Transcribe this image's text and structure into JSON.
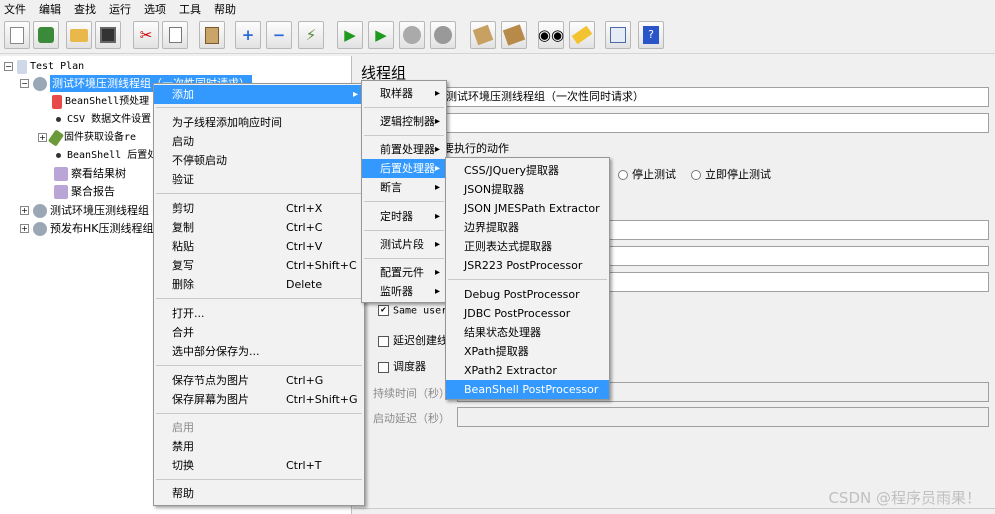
{
  "menubar": [
    "文件",
    "编辑",
    "查找",
    "运行",
    "选项",
    "工具",
    "帮助"
  ],
  "tree": {
    "test_plan": "Test Plan",
    "thread_group_1": "测试环境压测线程组（一次性同时请求）",
    "beanshell_pre": "BeanShell预处理",
    "csv": "CSV 数据文件设置",
    "fw_device": "固件获取设备re",
    "beanshell_post": "BeanShell 后置处",
    "view_results": "察看结果树",
    "aggregate": "聚合报告",
    "thread_group_2": "测试环境压测线程组",
    "thread_group_3": "预发布HK压测线程组"
  },
  "right": {
    "title": "线程组",
    "name_value": "测试环境压测线程组（一次性同时请求）",
    "action_label": "要执行的动作",
    "stop_test": "停止测试",
    "stop_now": "立即停止测试",
    "same_user": "Same user",
    "delay_create": "延迟创建线",
    "scheduler": "调度器",
    "duration": "持续时间（秒）",
    "startup_delay": "启动延迟（秒）"
  },
  "context_menu": {
    "add": "添加",
    "add_think_time": "为子线程添加响应时间",
    "start": "启动",
    "start_no_pause": "不停顿启动",
    "validate": "验证",
    "cut": "剪切",
    "cut_sc": "Ctrl+X",
    "copy": "复制",
    "copy_sc": "Ctrl+C",
    "paste": "粘贴",
    "paste_sc": "Ctrl+V",
    "duplicate": "复写",
    "duplicate_sc": "Ctrl+Shift+C",
    "delete": "删除",
    "delete_sc": "Delete",
    "open": "打开...",
    "merge": "合并",
    "save_selection": "选中部分保存为...",
    "save_node_image": "保存节点为图片",
    "save_node_image_sc": "Ctrl+G",
    "save_screen_image": "保存屏幕为图片",
    "save_screen_image_sc": "Ctrl+Shift+G",
    "enable": "启用",
    "disable": "禁用",
    "toggle": "切换",
    "toggle_sc": "Ctrl+T",
    "help": "帮助"
  },
  "add_menu": {
    "sampler": "取样器",
    "logic_controller": "逻辑控制器",
    "pre_processor": "前置处理器",
    "post_processor": "后置处理器",
    "assertion": "断言",
    "timer": "定时器",
    "test_fragment": "测试片段",
    "config_element": "配置元件",
    "listener": "监听器"
  },
  "post_menu": {
    "css": "CSS/JQuery提取器",
    "json": "JSON提取器",
    "jmespath": "JSON JMESPath Extractor",
    "boundary": "边界提取器",
    "regex": "正则表达式提取器",
    "jsr223": "JSR223 PostProcessor",
    "debug": "Debug PostProcessor",
    "jdbc": "JDBC PostProcessor",
    "result_status": "结果状态处理器",
    "xpath": "XPath提取器",
    "xpath2": "XPath2 Extractor",
    "beanshell": "BeanShell PostProcessor"
  },
  "watermark": "CSDN @程序员雨果！",
  "colors": {
    "selection": "#3399ff",
    "menu_bg": "#f2f2f2"
  }
}
